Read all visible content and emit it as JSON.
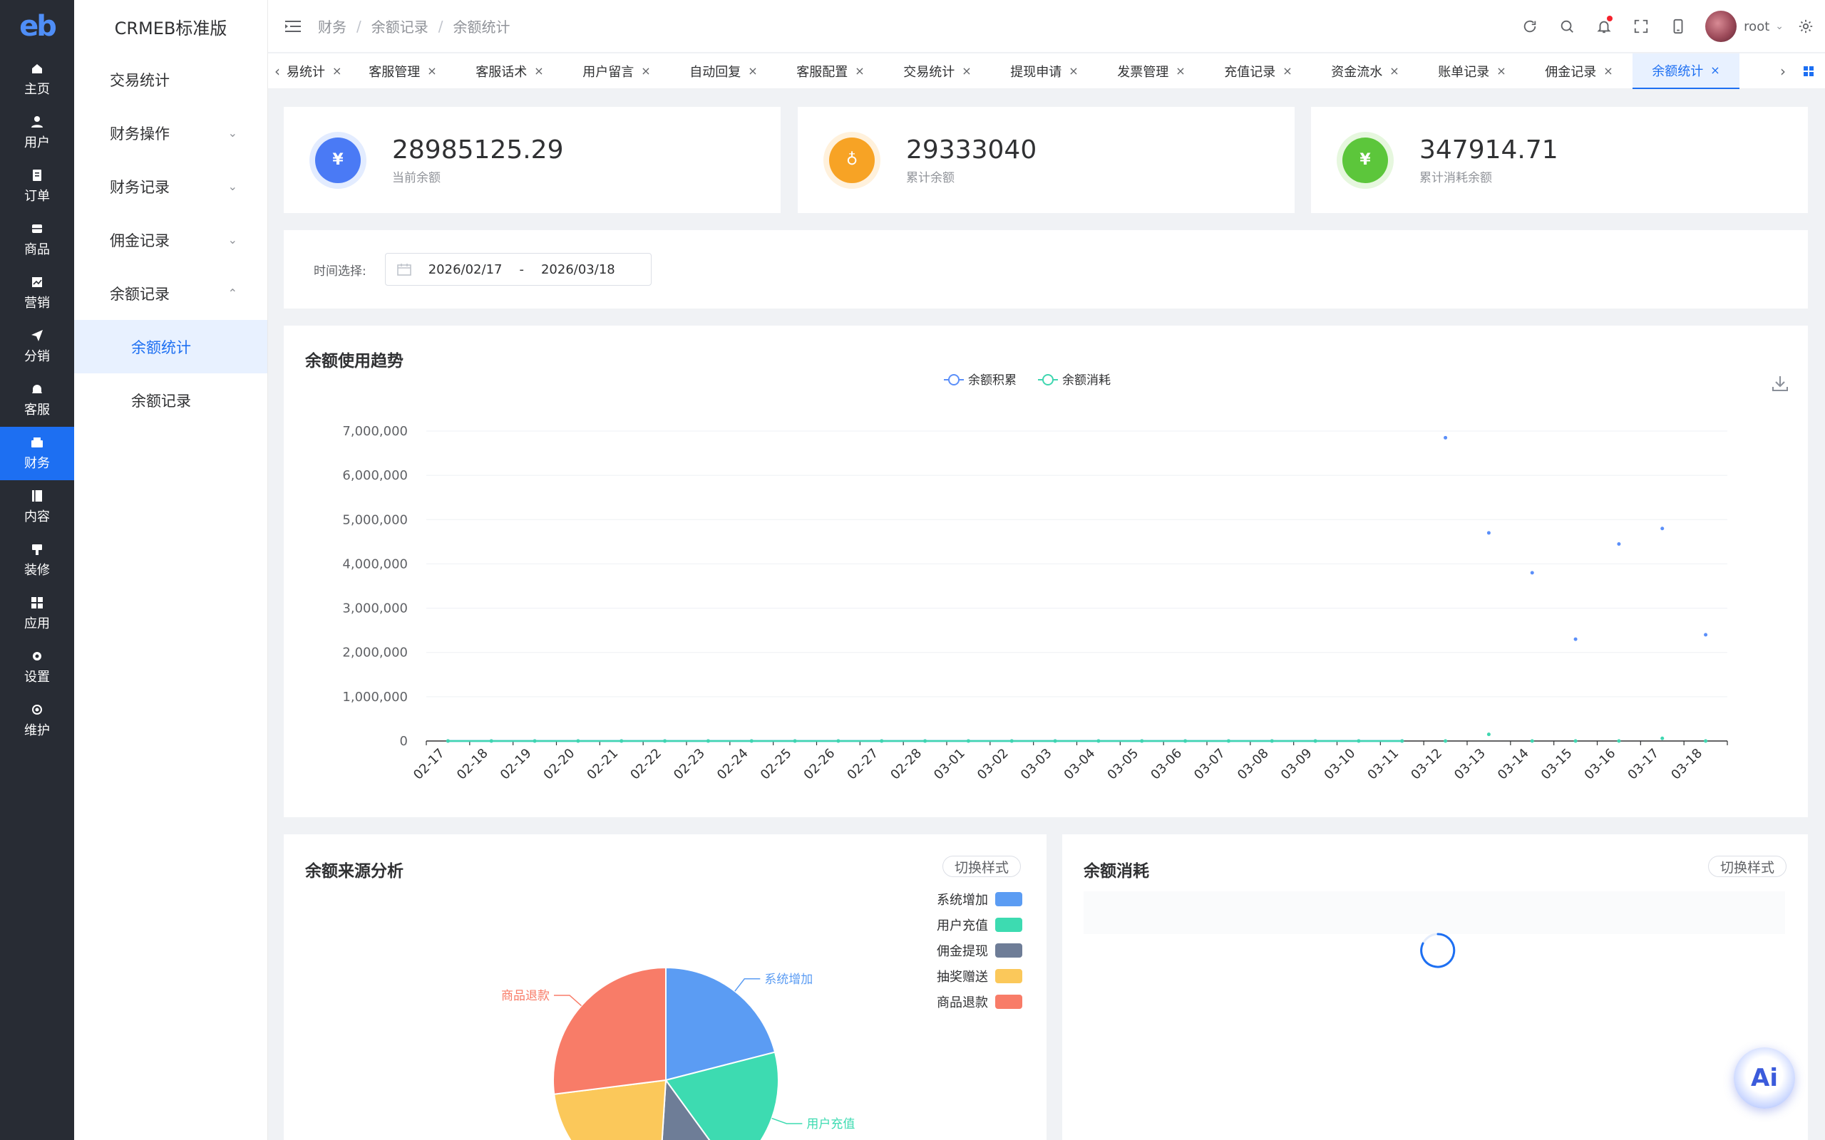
{
  "rail": {
    "logo": "eb",
    "items": [
      {
        "label": "主页",
        "icon": "home-icon"
      },
      {
        "label": "用户",
        "icon": "user-icon"
      },
      {
        "label": "订单",
        "icon": "order-icon"
      },
      {
        "label": "商品",
        "icon": "goods-icon"
      },
      {
        "label": "营销",
        "icon": "marketing-icon"
      },
      {
        "label": "分销",
        "icon": "distribution-icon"
      },
      {
        "label": "客服",
        "icon": "service-icon"
      },
      {
        "label": "财务",
        "icon": "finance-icon"
      },
      {
        "label": "内容",
        "icon": "content-icon"
      },
      {
        "label": "装修",
        "icon": "decoration-icon"
      },
      {
        "label": "应用",
        "icon": "apps-icon"
      },
      {
        "label": "设置",
        "icon": "settings-icon"
      },
      {
        "label": "维护",
        "icon": "maintenance-icon"
      }
    ],
    "active_index": 7
  },
  "submenu": {
    "brand": "CRMEB标准版",
    "items": [
      {
        "label": "交易统计",
        "chevron": ""
      },
      {
        "label": "财务操作",
        "chevron": "⌄"
      },
      {
        "label": "财务记录",
        "chevron": "⌄"
      },
      {
        "label": "佣金记录",
        "chevron": "⌄"
      },
      {
        "label": "余额记录",
        "chevron": "⌃"
      }
    ],
    "children": [
      {
        "label": "余额统计",
        "active": true
      },
      {
        "label": "余额记录",
        "active": false
      }
    ]
  },
  "header": {
    "breadcrumb": [
      "财务",
      "余额记录",
      "余额统计"
    ],
    "username": "root"
  },
  "tabs": {
    "items": [
      "易统计",
      "客服管理",
      "客服话术",
      "用户留言",
      "自动回复",
      "客服配置",
      "交易统计",
      "提现申请",
      "发票管理",
      "充值记录",
      "资金流水",
      "账单记录",
      "佣金记录",
      "余额统计"
    ],
    "active_index": 13
  },
  "stats": [
    {
      "value": "28985125.29",
      "label": "当前余额",
      "color": "#4a7af5",
      "ring": "#e3ecff",
      "icon": "money-bag-icon",
      "glyph": "¥"
    },
    {
      "value": "29333040",
      "label": "累计余额",
      "color": "#f7a325",
      "ring": "#fff1dc",
      "icon": "wallet-icon",
      "glyph": "♁"
    },
    {
      "value": "347914.71",
      "label": "累计消耗余额",
      "color": "#5cc63b",
      "ring": "#e6f7de",
      "icon": "money-bag-icon",
      "glyph": "¥"
    }
  ],
  "filter": {
    "label": "时间选择:",
    "start": "2026/02/17",
    "dash": "-",
    "end": "2026/03/18"
  },
  "trend": {
    "title": "余额使用趋势"
  },
  "chart_data": [
    {
      "type": "line",
      "title": "余额使用趋势",
      "x": [
        "02-17",
        "02-18",
        "02-19",
        "02-20",
        "02-21",
        "02-22",
        "02-23",
        "02-24",
        "02-25",
        "02-26",
        "02-27",
        "02-28",
        "03-01",
        "03-02",
        "03-03",
        "03-04",
        "03-05",
        "03-06",
        "03-07",
        "03-08",
        "03-09",
        "03-10",
        "03-11",
        "03-12",
        "03-13",
        "03-14",
        "03-15",
        "03-16",
        "03-17",
        "03-18"
      ],
      "series": [
        {
          "name": "余额积累",
          "color": "#5b8ff9",
          "values": [
            0,
            0,
            0,
            0,
            0,
            0,
            0,
            0,
            0,
            0,
            0,
            0,
            0,
            0,
            0,
            0,
            0,
            0,
            0,
            0,
            0,
            0,
            0,
            6850000,
            4700000,
            3800000,
            2300000,
            4450000,
            4800000,
            2400000
          ]
        },
        {
          "name": "余额消耗",
          "color": "#3fd6b0",
          "values": [
            0,
            0,
            0,
            0,
            0,
            0,
            0,
            0,
            0,
            0,
            0,
            0,
            0,
            0,
            0,
            0,
            0,
            0,
            0,
            0,
            0,
            0,
            0,
            0,
            150000,
            0,
            0,
            0,
            60000,
            0
          ]
        }
      ],
      "y_ticks": [
        "0",
        "1,000,000",
        "2,000,000",
        "3,000,000",
        "4,000,000",
        "5,000,000",
        "6,000,000",
        "7,000,000"
      ],
      "ylim": [
        0,
        7000000
      ],
      "legend": "top-center",
      "grid": true
    },
    {
      "type": "pie",
      "title": "余额来源分析",
      "categories": [
        "系统增加",
        "用户充值",
        "佣金提现",
        "抽奖赠送",
        "商品退款"
      ],
      "colors": [
        "#5b9cf3",
        "#3ddbb1",
        "#6e7d97",
        "#fbc85a",
        "#f87c68"
      ],
      "values": [
        21,
        19,
        11,
        22,
        27
      ],
      "legend": "top-right"
    }
  ],
  "source": {
    "title": "余额来源分析",
    "switch_label": "切换样式"
  },
  "consume": {
    "title": "余额消耗",
    "switch_label": "切换样式"
  },
  "ai": {
    "label": "Ai"
  }
}
